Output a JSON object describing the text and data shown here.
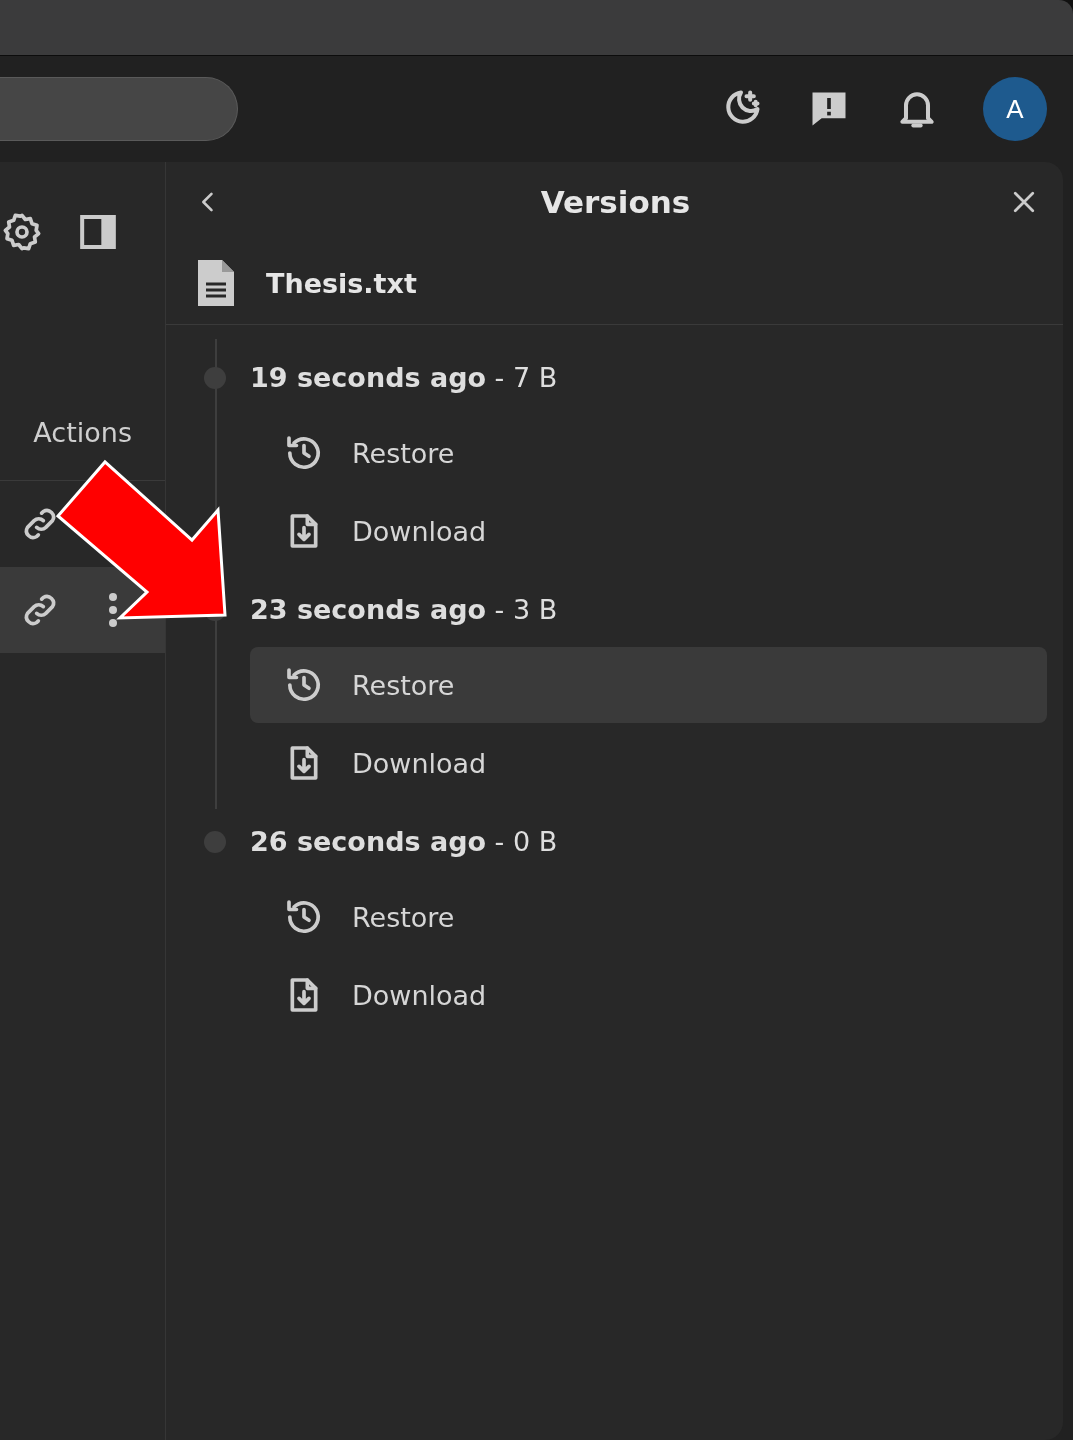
{
  "header": {
    "avatar": "A"
  },
  "sidebar": {
    "column_label": "Actions",
    "rows": [
      {
        "highlighted": false
      },
      {
        "highlighted": true
      }
    ]
  },
  "panel": {
    "title": "Versions",
    "file": "Thesis.txt",
    "versions": [
      {
        "label": "**19 seconds ago** - 7 B",
        "actions": [
          {
            "kind": "restore",
            "label": "Restore",
            "highlighted": false
          },
          {
            "kind": "download",
            "label": "Download",
            "highlighted": false
          }
        ]
      },
      {
        "label": "**23 seconds ago** - 3 B",
        "actions": [
          {
            "kind": "restore",
            "label": "Restore",
            "highlighted": true
          },
          {
            "kind": "download",
            "label": "Download",
            "highlighted": false
          }
        ]
      },
      {
        "label": "**26 seconds ago** - 0 B",
        "actions": [
          {
            "kind": "restore",
            "label": "Restore",
            "highlighted": false
          },
          {
            "kind": "download",
            "label": "Download",
            "highlighted": false
          }
        ]
      }
    ]
  }
}
